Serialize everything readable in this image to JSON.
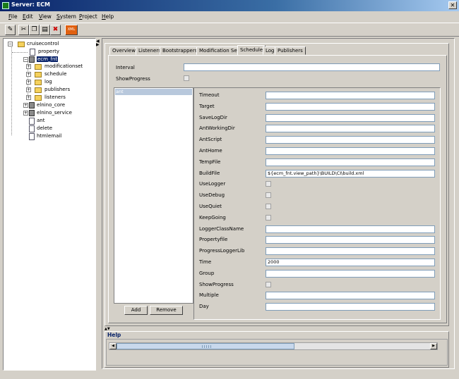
{
  "window": {
    "title": "Server: ECM",
    "close_label": "✕"
  },
  "menu": [
    {
      "label": "File",
      "u": "F",
      "rest": "ile"
    },
    {
      "label": "Edit",
      "u": "E",
      "rest": "dit"
    },
    {
      "label": "View",
      "u": "V",
      "rest": "iew"
    },
    {
      "label": "System",
      "u": "S",
      "rest": "ystem"
    },
    {
      "label": "Project",
      "u": "P",
      "rest": "roject"
    },
    {
      "label": "Help",
      "u": "H",
      "rest": "elp"
    }
  ],
  "toolbar": {
    "xml_label": "XML"
  },
  "tree": {
    "root": "cruisecontrol",
    "property": "property",
    "selected_project": "ecm_fnt",
    "children": [
      "modificationset",
      "schedule",
      "log",
      "publishers",
      "listeners"
    ],
    "other_projects": [
      "elnino_core",
      "elnino_service"
    ],
    "plugins": [
      "ant",
      "delete",
      "htmlemail"
    ]
  },
  "tabs": [
    "Overview",
    "Listeners",
    "Bootstrappers",
    "Modification Sets",
    "Schedule",
    "Log",
    "Publishers"
  ],
  "active_tab": "Schedule",
  "schedule": {
    "interval_label": "Interval",
    "interval_value": "",
    "showprogress_label": "ShowProgress",
    "list_item": "ant",
    "add_label": "Add",
    "remove_label": "Remove"
  },
  "properties": [
    {
      "label": "Timeout",
      "type": "text",
      "value": ""
    },
    {
      "label": "Target",
      "type": "text",
      "value": ""
    },
    {
      "label": "SaveLogDir",
      "type": "text",
      "value": ""
    },
    {
      "label": "AntWorkingDir",
      "type": "text",
      "value": ""
    },
    {
      "label": "AntScript",
      "type": "text",
      "value": ""
    },
    {
      "label": "AntHome",
      "type": "text",
      "value": ""
    },
    {
      "label": "TempFile",
      "type": "text",
      "value": ""
    },
    {
      "label": "BuildFile",
      "type": "text",
      "value": "${ecm_fnt.view_path}\\BUILD\\CI\\build.xml"
    },
    {
      "label": "UseLogger",
      "type": "check",
      "value": ""
    },
    {
      "label": "UseDebug",
      "type": "check",
      "value": ""
    },
    {
      "label": "UseQuiet",
      "type": "check",
      "value": ""
    },
    {
      "label": "KeepGoing",
      "type": "check",
      "value": ""
    },
    {
      "label": "LoggerClassName",
      "type": "text",
      "value": ""
    },
    {
      "label": "Propertyfile",
      "type": "text",
      "value": ""
    },
    {
      "label": "ProgressLoggerLib",
      "type": "text",
      "value": ""
    },
    {
      "label": "Time",
      "type": "text",
      "value": "2000"
    },
    {
      "label": "Group",
      "type": "text",
      "value": ""
    },
    {
      "label": "ShowProgress",
      "type": "check",
      "value": ""
    },
    {
      "label": "Multiple",
      "type": "text",
      "value": ""
    },
    {
      "label": "Day",
      "type": "text",
      "value": ""
    }
  ],
  "help": {
    "title": "Help"
  },
  "colors": {
    "title_start": "#0a246a",
    "title_end": "#a6caf0",
    "selection": "#0a246a",
    "folder": "#f5d15c"
  }
}
